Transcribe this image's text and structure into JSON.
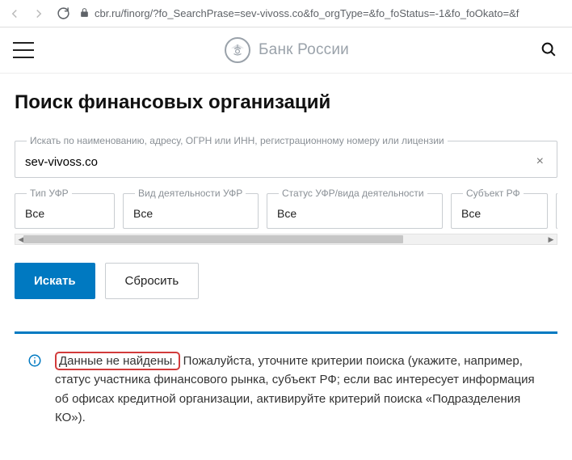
{
  "browser": {
    "url": "cbr.ru/finorg/?fo_SearchPrase=sev-vivoss.co&fo_orgType=&fo_foStatus=-1&fo_foOkato=&f"
  },
  "header": {
    "brand": "Банк России"
  },
  "page": {
    "title": "Поиск финансовых организаций"
  },
  "search": {
    "label": "Искать по наименованию, адресу, ОГРН или ИНН, регистрационному номеру или лицензии",
    "value": "sev-vivoss.co"
  },
  "filters": {
    "type": {
      "label": "Тип УФР",
      "value": "Все"
    },
    "activity": {
      "label": "Вид деятельности УФР",
      "value": "Все"
    },
    "status": {
      "label": "Статус УФР/вида деятельности",
      "value": "Все"
    },
    "subject": {
      "label": "Субъект РФ",
      "value": "Все"
    }
  },
  "buttons": {
    "search": "Искать",
    "reset": "Сбросить"
  },
  "alert": {
    "highlight": "Данные не найдены.",
    "rest": " Пожалуйста, уточните критерии поиска (укажите, например, статус участника финансового рынка, субъект РФ; если вас интересует информация об офисах кредитной организации, активируйте критерий поиска «Подразделения КО»)."
  }
}
